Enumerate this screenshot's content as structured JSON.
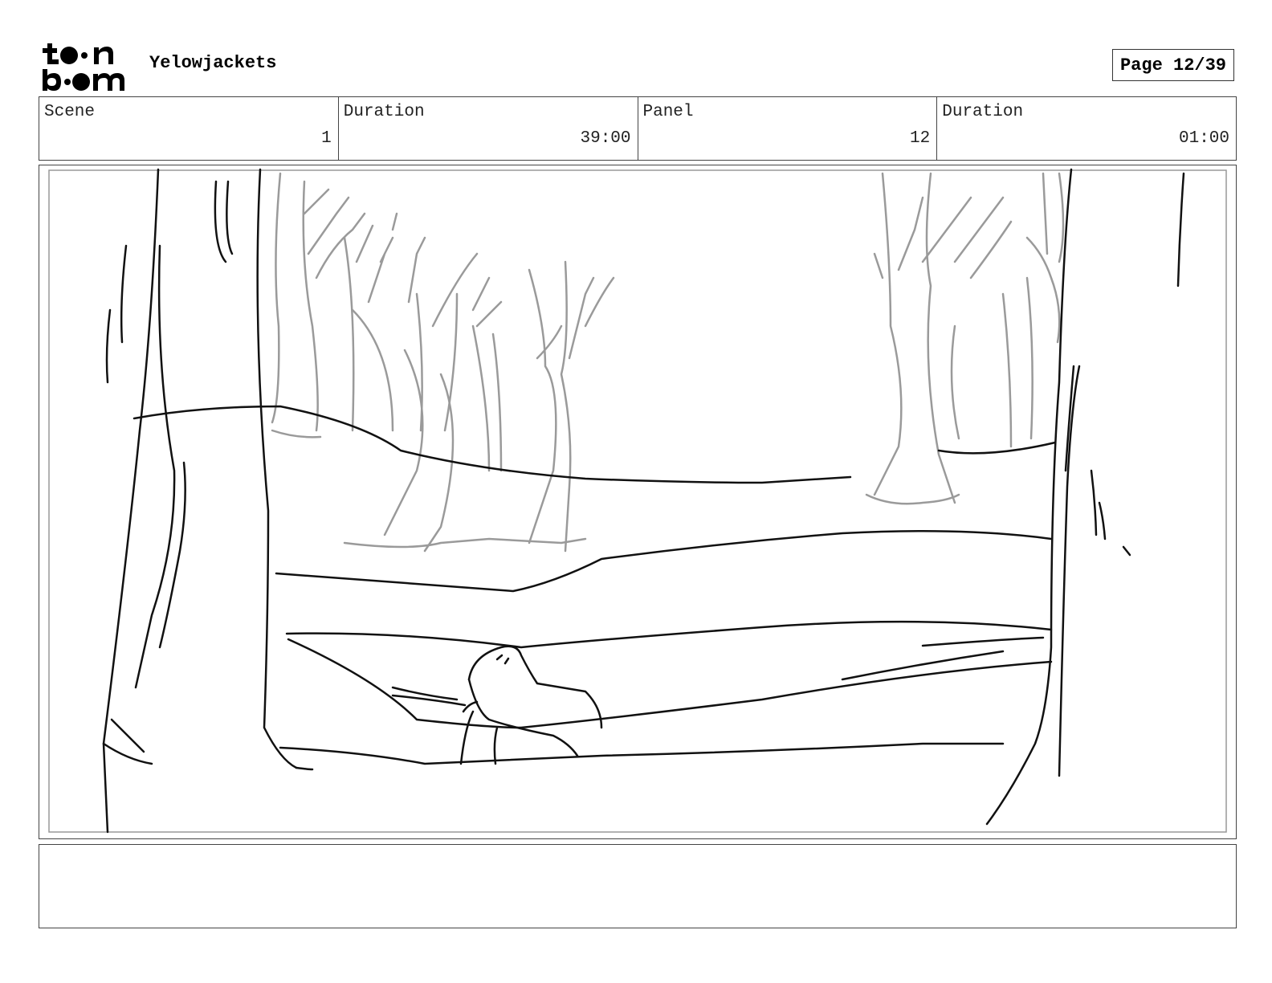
{
  "header": {
    "logo": "toonboom-logo",
    "project_title": "Yelowjackets",
    "page_label": "Page 12/39"
  },
  "info": {
    "scene_label": "Scene",
    "scene_value": "1",
    "scene_duration_label": "Duration",
    "scene_duration_value": "39:00",
    "panel_label": "Panel",
    "panel_value": "12",
    "panel_duration_label": "Duration",
    "panel_duration_value": "01:00"
  },
  "notes": {
    "text": ""
  }
}
